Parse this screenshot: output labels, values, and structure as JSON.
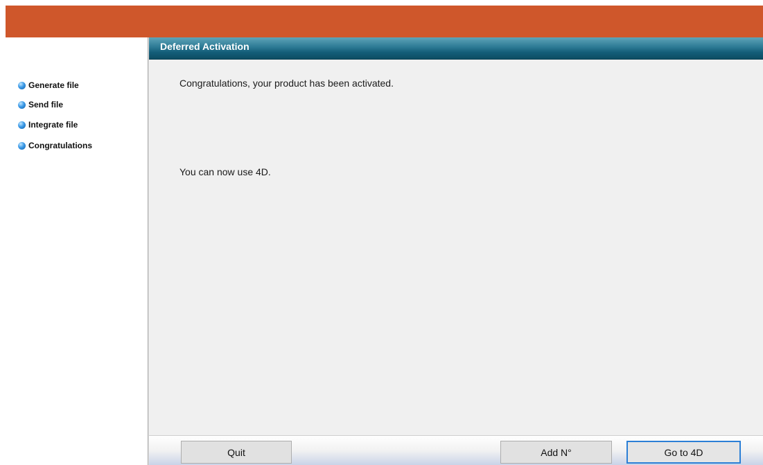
{
  "header": {
    "accent_color": "#cf572b"
  },
  "sidebar": {
    "steps": [
      {
        "label": "Generate file",
        "icon": "blue-bullet-icon"
      },
      {
        "label": "Send file",
        "icon": "blue-bullet-icon"
      },
      {
        "label": "Integrate file",
        "icon": "blue-bullet-icon"
      },
      {
        "label": "Congratulations",
        "icon": "blue-bullet-icon"
      }
    ]
  },
  "panel": {
    "title": "Deferred Activation",
    "message_primary": "Congratulations, your product has been activated.",
    "message_secondary": "You can now use 4D."
  },
  "footer": {
    "quit_label": "Quit",
    "add_label": "Add N°",
    "go_label": "Go to 4D"
  }
}
